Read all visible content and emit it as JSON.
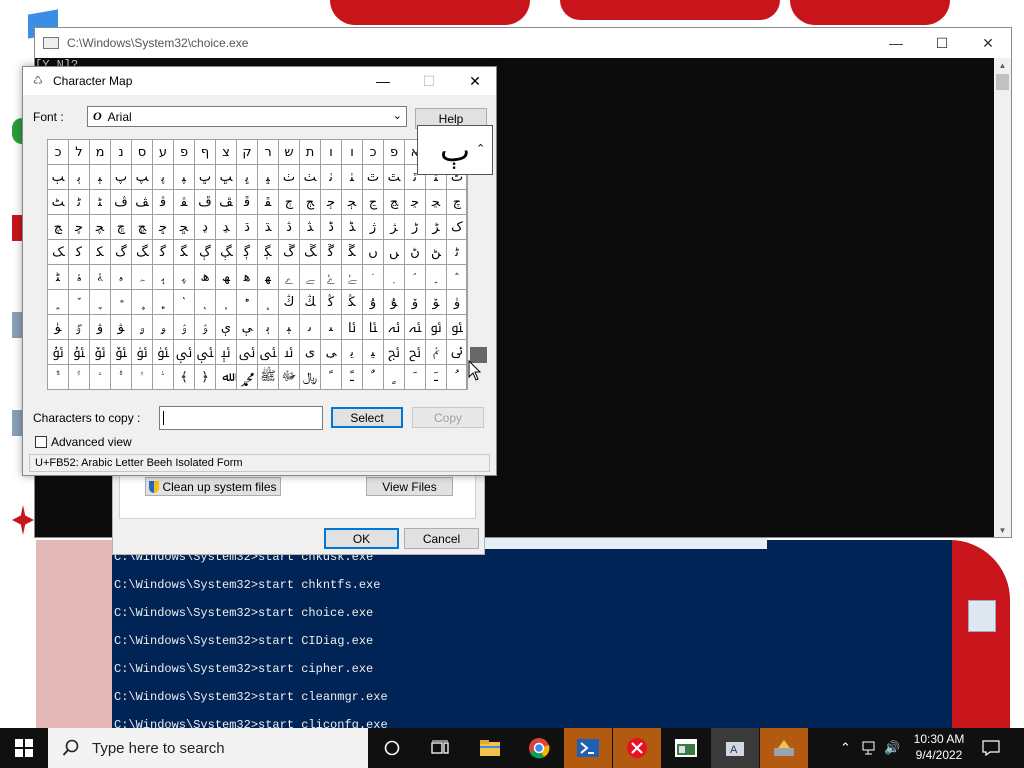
{
  "console": {
    "title": "C:\\Windows\\System32\\choice.exe",
    "prompt_fragment": "[Y,N]?"
  },
  "powershell": {
    "lines": [
      "C:\\Windows\\System32>start chkdsk.exe",
      "C:\\Windows\\System32>start chkntfs.exe",
      "C:\\Windows\\System32>start choice.exe",
      "C:\\Windows\\System32>start CIDiag.exe",
      "C:\\Windows\\System32>start cipher.exe",
      "C:\\Windows\\System32>start cleanmgr.exe",
      "C:\\Windows\\System32>start cliconfg.exe"
    ]
  },
  "cleanup_dialog": {
    "clean_system_files": "Clean up system files",
    "view_files": "View Files",
    "ok": "OK",
    "cancel": "Cancel"
  },
  "charmap": {
    "title": "Character Map",
    "font_label": "Font :",
    "font_value": "Arial",
    "font_icon": "O",
    "help": "Help",
    "zoom_char": "ٻ",
    "characters_to_copy_label": "Characters to copy :",
    "characters_to_copy_value": "",
    "select": "Select",
    "copy": "Copy",
    "advanced_view": "Advanced view",
    "status": "U+FB52: Arabic Letter Beeh Isolated Form",
    "rows": [
      [
        "כ",
        "ל",
        "מ",
        "נ",
        "ס",
        "ע",
        "פ",
        "ף",
        "צ",
        "ק",
        "ר",
        "ש",
        "ת",
        "ו",
        "ו",
        "כ",
        "פ",
        "א",
        "ﬡ",
        "ﬢ"
      ],
      [
        "ﭓ",
        "ﭔ",
        "ﭕ",
        "ﭖ",
        "ﭗ",
        "ﭘ",
        "ﭙ",
        "ﭚ",
        "ﭛ",
        "ﭜ",
        "ﭝ",
        "ﭞ",
        "ﭟ",
        "ﭠ",
        "ﭡ",
        "ﭢ",
        "ﭣ",
        "ﭤ",
        "ﭥ",
        "ﭦ"
      ],
      [
        "ﭧ",
        "ﭨ",
        "ﭩ",
        "ﭪ",
        "ﭫ",
        "ﭬ",
        "ﭭ",
        "ﭮ",
        "ﭯ",
        "ﭰ",
        "ﭱ",
        "ﭲ",
        "ﭳ",
        "ﭴ",
        "ﭵ",
        "ﭶ",
        "ﭷ",
        "ﭸ",
        "ﭹ",
        "ﭺ"
      ],
      [
        "ﭻ",
        "ﭼ",
        "ﭽ",
        "ﭾ",
        "ﭿ",
        "ﮀ",
        "ﮁ",
        "ﮂ",
        "ﮃ",
        "ﮄ",
        "ﮅ",
        "ﮆ",
        "ﮇ",
        "ﮈ",
        "ﮉ",
        "ﮊ",
        "ﮋ",
        "ﮌ",
        "ﮍ",
        "ﮎ"
      ],
      [
        "ﮏ",
        "ﮐ",
        "ﮑ",
        "ﮒ",
        "ﮓ",
        "ﮔ",
        "ﮕ",
        "ﮖ",
        "ﮗ",
        "ﮘ",
        "ﮙ",
        "ﮚ",
        "ﮛ",
        "ﮜ",
        "ﮝ",
        "ﮞ",
        "ﮟ",
        "ﮠ",
        "ﮡ",
        "ﮢ"
      ],
      [
        "ﮣ",
        "ﮤ",
        "ﮥ",
        "ﮦ",
        "ﮧ",
        "ﮨ",
        "ﮩ",
        "ﮪ",
        "ﮫ",
        "ﮬ",
        "ﮭ",
        "ﮮ",
        "ﮯ",
        "ﮰ",
        "ﮱ",
        "﮲",
        "﮳",
        "﮴",
        "﮵",
        "﮶"
      ],
      [
        "﮷",
        "﮸",
        "﮹",
        "﮺",
        "﮻",
        "﮼",
        "﮽",
        "﮾",
        "﮿",
        "﯀",
        "﯁",
        "ﯓ",
        "ﯔ",
        "ﯕ",
        "ﯖ",
        "ﯗ",
        "ﯘ",
        "ﯙ",
        "ﯚ",
        "ﯛ"
      ],
      [
        "ﯜ",
        "ﯝ",
        "ﯞ",
        "ﯟ",
        "ﯠ",
        "ﯡ",
        "ﯢ",
        "ﯣ",
        "ﯤ",
        "ﯥ",
        "ﯦ",
        "ﯧ",
        "ﯨ",
        "ﯩ",
        "ﯪ",
        "ﯫ",
        "ﯬ",
        "ﯭ",
        "ﯮ",
        "ﯯ"
      ],
      [
        "ﯰ",
        "ﯱ",
        "ﯲ",
        "ﯳ",
        "ﯴ",
        "ﯵ",
        "ﯶ",
        "ﯷ",
        "ﯸ",
        "ﯹ",
        "ﯺ",
        "ﯻ",
        "ﯼ",
        "ﯽ",
        "ﯾ",
        "ﯿ",
        "ﰀ",
        "ﰁ",
        "ﰂ",
        "ﰃ"
      ],
      [
        "ﱞ",
        "ﱟ",
        "ﱠ",
        "ﱡ",
        "ﱢ",
        "ﱣ",
        "﴾",
        "﴿",
        "ﷲ",
        "ﷴ",
        "ﷺ",
        "ﷻ",
        "﷼",
        "ﹰ",
        "ﹱ",
        "ﹲ",
        "ﹴ",
        "ﹶ",
        "ﹷ",
        "ﹸ"
      ]
    ]
  },
  "taskbar": {
    "search_placeholder": "Type here to search",
    "time": "10:30 AM",
    "date": "9/4/2022"
  },
  "colors": {
    "console_bg": "#0c0c0c",
    "powershell_bg": "#012456",
    "accent": "#0078d7",
    "desktop_red": "#c8151c"
  }
}
